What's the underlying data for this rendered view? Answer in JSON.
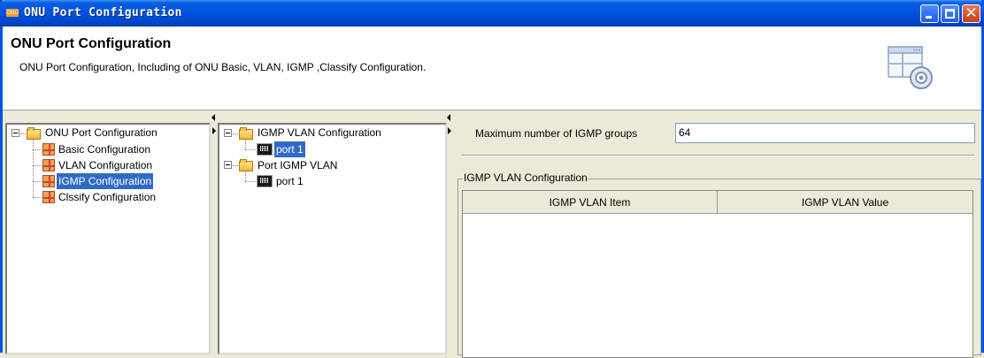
{
  "window": {
    "title": "ONU Port Configuration",
    "app_icon_text": "ONU"
  },
  "header": {
    "title": "ONU Port Configuration",
    "description": "ONU Port Configuration, Including of ONU Basic, VLAN, IGMP ,Classify Configuration."
  },
  "nav_tree": {
    "root": "ONU Port Configuration",
    "items": [
      {
        "label": "Basic Configuration",
        "selected": false
      },
      {
        "label": "VLAN Configuration",
        "selected": false
      },
      {
        "label": "IGMP Configuration",
        "selected": true
      },
      {
        "label": "Clssify Configuration",
        "selected": false
      }
    ]
  },
  "port_tree": {
    "groups": [
      {
        "label": "IGMP VLAN Configuration",
        "children": [
          {
            "label": "port 1",
            "selected": true
          }
        ]
      },
      {
        "label": "Port IGMP VLAN",
        "children": [
          {
            "label": "port 1",
            "selected": false
          }
        ]
      }
    ]
  },
  "igmp": {
    "max_groups_label": "Maximum number of IGMP groups",
    "max_groups_value": "64",
    "group_title": "IGMP VLAN Configuration",
    "columns": [
      "IGMP VLAN Item",
      "IGMP VLAN Value"
    ],
    "rows": []
  },
  "colors": {
    "titlebar": "#0054e3",
    "selection": "#316ac5",
    "window_bg": "#ece9d8"
  }
}
